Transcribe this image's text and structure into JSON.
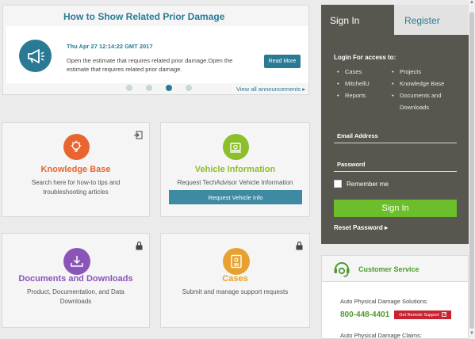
{
  "announcement": {
    "title": "How to Show Related Prior Damage",
    "date": "Thu Apr 27 12:14:22 GMT 2017",
    "text": "Open the estimate that requires related prior damage.Open the estimate that requires related prior damage.",
    "read_more": "Read More",
    "view_all": "View all announcements ▸",
    "slides_total": 4,
    "active_slide": 3
  },
  "tiles": {
    "knowledge_base": {
      "title": "Knowledge Base",
      "desc": "Search here for how-to tips and troubleshooting articles",
      "color": "#e8652f"
    },
    "vehicle_info": {
      "title": "Vehicle Information",
      "desc": "Request TechAdvisor Vehicle Information",
      "button": "Request Vehicle Info",
      "color": "#8cbf2b"
    },
    "documents": {
      "title": "Documents and Downloads",
      "desc": "Product, Documentation, and Data Downloads",
      "color": "#8b55b8"
    },
    "cases": {
      "title": "Cases",
      "desc": "Submit and manage support requests",
      "color": "#e8a12f"
    }
  },
  "signin": {
    "tab_signin": "Sign In",
    "tab_register": "Register",
    "login_title": "Login For access to:",
    "left_items": [
      "Cases",
      "MitchellU",
      "Reports"
    ],
    "right_items": [
      "Projects",
      "Knowledge Base",
      "Documents and Downloads"
    ],
    "email_label": "Email Address",
    "password_label": "Password",
    "remember": "Remember me",
    "button": "Sign In",
    "reset": "Reset Password ▸"
  },
  "customer_service": {
    "title": "Customer Service",
    "apd_label": "Auto Physical Damage Solutions:",
    "phone": "800-448-4401",
    "remote_support": "Get Remote Support",
    "apd_claims": "Auto Physical Damage Claims:"
  },
  "colors": {
    "accent": "#2a7a95",
    "green": "#6cbf2a",
    "panel": "#57574f"
  }
}
